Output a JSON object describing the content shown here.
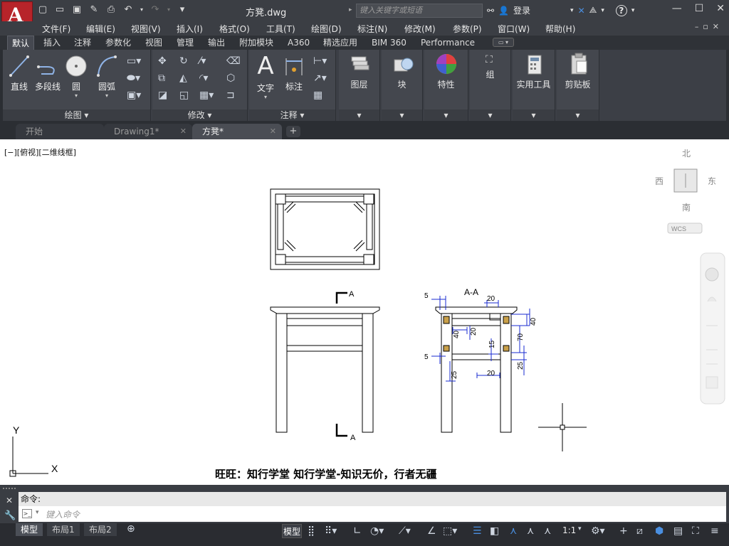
{
  "app": {
    "logo_letter": "A",
    "title": "方凳.dwg",
    "search_placeholder": "键入关键字或短语",
    "login_label": "登录"
  },
  "menus": [
    "文件(F)",
    "编辑(E)",
    "视图(V)",
    "插入(I)",
    "格式(O)",
    "工具(T)",
    "绘图(D)",
    "标注(N)",
    "修改(M)",
    "参数(P)",
    "窗口(W)",
    "帮助(H)"
  ],
  "ribbon_tabs": [
    "默认",
    "插入",
    "注释",
    "参数化",
    "视图",
    "管理",
    "输出",
    "附加模块",
    "A360",
    "精选应用",
    "BIM 360",
    "Performance"
  ],
  "ribbon_active_tab": "默认",
  "panels": {
    "draw": {
      "label": "绘图",
      "tools": [
        "直线",
        "多段线",
        "圆",
        "圆弧"
      ]
    },
    "modify": {
      "label": "修改"
    },
    "annotation": {
      "label": "注释",
      "tools": [
        "文字",
        "标注"
      ]
    },
    "layers": {
      "label": "图层"
    },
    "block": {
      "label": "块"
    },
    "properties": {
      "label": "特性"
    },
    "group": {
      "label": "组"
    },
    "utilities": {
      "label": "实用工具"
    },
    "clipboard": {
      "label": "剪贴板"
    }
  },
  "file_tabs": [
    {
      "label": "开始",
      "active": false
    },
    {
      "label": "Drawing1*",
      "active": false
    },
    {
      "label": "方凳*",
      "active": true
    }
  ],
  "viewport_label": "[−][俯视][二维线框]",
  "viewcube": {
    "north": "北",
    "south": "南",
    "east": "东",
    "west": "西",
    "face": "上",
    "wcs": "WCS"
  },
  "drawing": {
    "section_mark": "A",
    "section_title": "A-A",
    "dimensions": [
      "5",
      "20",
      "40",
      "20",
      "40",
      "70",
      "15",
      "5",
      "25",
      "25",
      "20"
    ],
    "ucs_x": "X",
    "ucs_y": "Y",
    "caption": "旺旺：知行学堂 知行学堂-知识无价，行者无疆"
  },
  "command": {
    "history": "命令:",
    "placeholder": "键入命令"
  },
  "layout_tabs": [
    "模型",
    "布局1",
    "布局2"
  ],
  "status": {
    "model": "模型",
    "scale": "1:1"
  }
}
